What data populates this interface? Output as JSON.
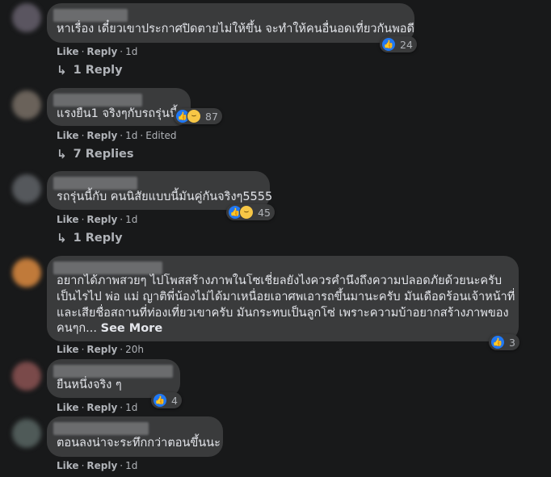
{
  "comments": [
    {
      "text_lines": [
        "หาเรื่อง เดี๋ยวเขาประกาศปิดตายไม่ให้ขึ้น จะทำให้คนอื่นอดเที่ยวกันพอดี"
      ],
      "like_label": "Like",
      "reply_label": "Reply",
      "time": "1d",
      "edited": "",
      "reaction_count": "24",
      "reactions": [
        "like-icon"
      ],
      "replies_label": "1 Reply",
      "avatar_color": "#5a5560"
    },
    {
      "text_lines": [
        "แรงยืน1 จริงๆกับรถรุ่นนี้"
      ],
      "like_label": "Like",
      "reply_label": "Reply",
      "time": "1d",
      "edited": "Edited",
      "reaction_count": "87",
      "reactions": [
        "like-icon",
        "haha-icon"
      ],
      "replies_label": "7 Replies",
      "avatar_color": "#6a625a"
    },
    {
      "text_lines": [
        "รถรุ่นนี้กับ คนนิสัยแบบนี้มันคู่กันจริงๆ5555"
      ],
      "like_label": "Like",
      "reply_label": "Reply",
      "time": "1d",
      "edited": "",
      "reaction_count": "45",
      "reactions": [
        "like-icon",
        "haha-icon"
      ],
      "replies_label": "1 Reply",
      "avatar_color": "#55585c"
    },
    {
      "text_lines": [
        "อยากได้ภาพสวยๆ ไปโพสสร้างภาพในโซเชี่ยลยังไงควรคำนึงถึงความปลอดภัยด้วยนะครับ",
        "เป็นไรไป พ่อ แม่ ญาติพี่น้องไม่ได้มาเหนื่อยเอาศพเอารถขึ้นมานะครับ มันเดือดร้อนเจ้าหน้าที่",
        "และเสียชื่อสถานที่ท่องเที่ยวเขาครับ มันกระทบเป็นลูกโซ่ เพราะความบ้าอยากสร้างภาพของ",
        "คนๆก..."
      ],
      "see_more": "See More",
      "like_label": "Like",
      "reply_label": "Reply",
      "time": "20h",
      "edited": "",
      "reaction_count": "3",
      "reactions": [
        "like-icon"
      ],
      "replies_label": "",
      "avatar_color": "#c07a3a"
    },
    {
      "text_lines": [
        "ยืนหนึ่งจริง ๆ"
      ],
      "like_label": "Like",
      "reply_label": "Reply",
      "time": "1d",
      "edited": "",
      "reaction_count": "4",
      "reactions": [
        "like-icon"
      ],
      "replies_label": "",
      "avatar_color": "#7a4a4a"
    },
    {
      "text_lines": [
        "ตอนลงน่าจะระทึกกว่าตอนขึ้นนะ"
      ],
      "like_label": "Like",
      "reply_label": "Reply",
      "time": "1d",
      "edited": "",
      "reaction_count": "",
      "reactions": [],
      "replies_label": "",
      "avatar_color": "#4f5a58"
    }
  ]
}
